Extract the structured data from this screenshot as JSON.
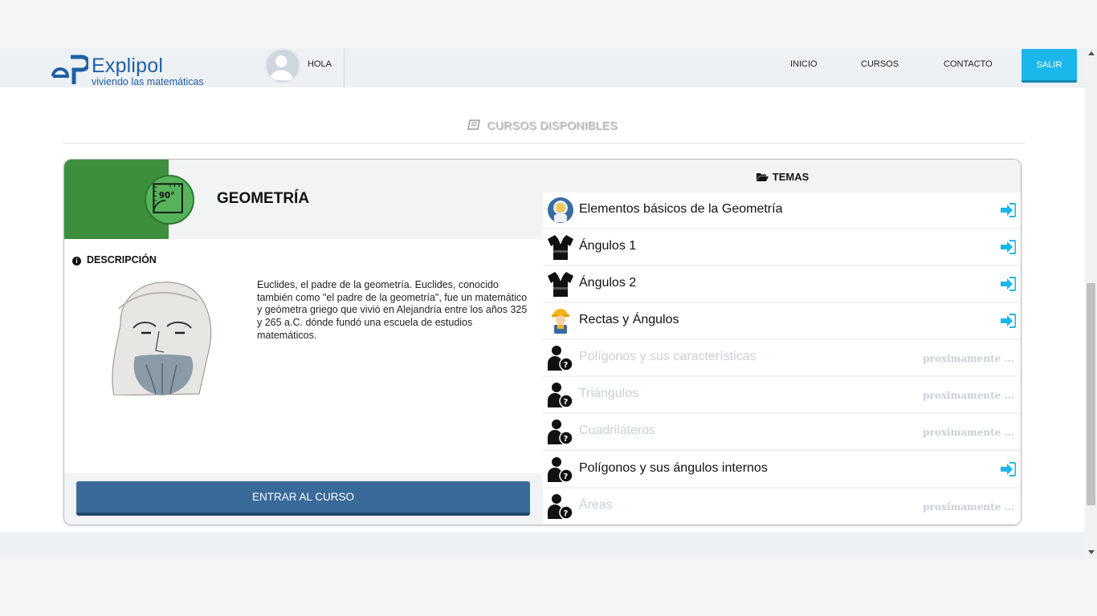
{
  "brand": {
    "name": "Explipol",
    "tagline": "viviendo las matemáticas"
  },
  "header": {
    "greeting": "HOLA",
    "nav": [
      "INICIO",
      "CURSOS",
      "CONTACTO"
    ],
    "logout": "SALIR"
  },
  "section": {
    "title": "CURSOS DISPONIBLES"
  },
  "course": {
    "badge_text": "90°",
    "title": "GEOMETRÍA",
    "description_label": "DESCRIPCIÓN",
    "description": "Euclides, el padre de la geometría. Euclides, conocido también como \"el padre de la geometría\", fue un matemático y geómetra griego que vivió en Alejandría entre los años 325 y 265 a.C. dónde fundó una escuela de estudios matemáticos.",
    "enter_button": "ENTRAR AL CURSO"
  },
  "temas": {
    "heading": "TEMAS",
    "items": [
      {
        "label": "Elementos básicos de la Geometría",
        "icon": "astronaut-icon",
        "available": true
      },
      {
        "label": "Ángulos 1",
        "icon": "judo-gi-icon",
        "available": true
      },
      {
        "label": "Ángulos 2",
        "icon": "judo-gi-icon",
        "available": true
      },
      {
        "label": "Rectas y Ángulos",
        "icon": "construction-worker-icon",
        "available": true
      },
      {
        "label": "Polígonos y sus características",
        "icon": "user-question-icon",
        "available": false,
        "status": "proximamente ..."
      },
      {
        "label": "Triángulos",
        "icon": "user-question-icon",
        "available": false,
        "status": "proximamente ..."
      },
      {
        "label": "Cuadriláteros",
        "icon": "user-question-icon",
        "available": false,
        "status": "proximamente ..."
      },
      {
        "label": "Polígonos y sus ángulos internos",
        "icon": "user-question-icon",
        "available": true
      },
      {
        "label": "Áreas",
        "icon": "user-question-icon",
        "available": false,
        "status": "proximamente ..."
      }
    ]
  },
  "colors": {
    "accent": "#1ab7ea",
    "course_green": "#3d8f3d",
    "button_blue": "#3a6a9a",
    "disabled_text": "#c9d0d8"
  }
}
